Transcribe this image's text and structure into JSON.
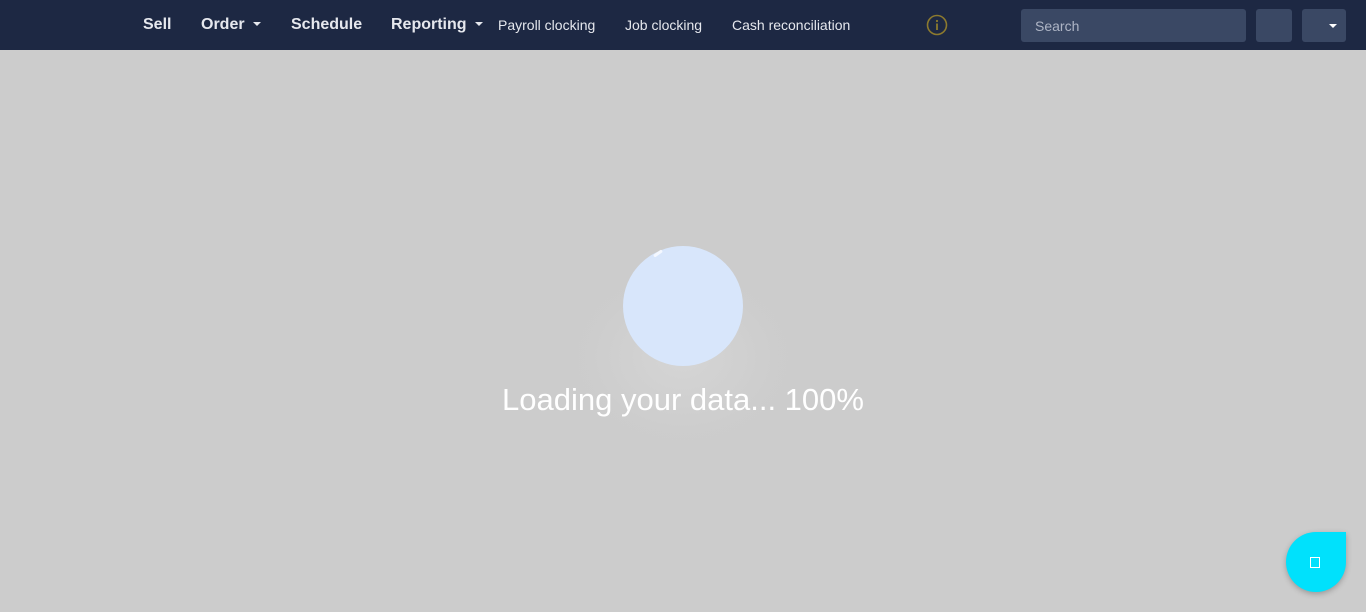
{
  "nav": {
    "items": [
      {
        "label": "Sell"
      },
      {
        "label": "Order"
      },
      {
        "label": "Schedule"
      },
      {
        "label": "Reporting"
      },
      {
        "label": "Payroll clocking"
      },
      {
        "label": "Job clocking"
      },
      {
        "label": "Cash reconciliation"
      }
    ],
    "info_icon": "info-circle-icon",
    "info_icon_color": "#8c7a2e"
  },
  "search": {
    "placeholder": "Search"
  },
  "loader": {
    "text": "Loading your data... 100%",
    "progress": 1.0,
    "circle_color": "#d8e6fb"
  },
  "chat_button": {
    "icon": "chat-icon",
    "color": "#00e1fc"
  },
  "colors": {
    "topbar": "#1d2843",
    "overlay": "#cccccc",
    "control": "#3a4864"
  }
}
